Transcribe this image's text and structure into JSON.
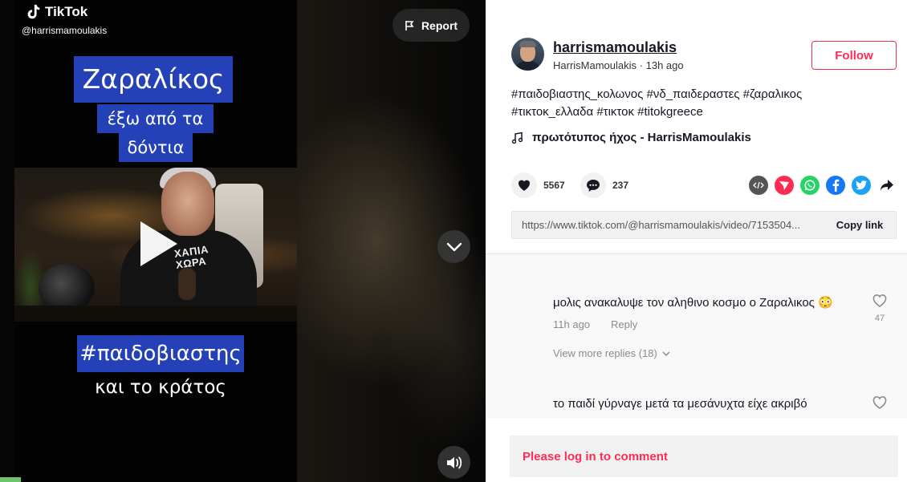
{
  "video": {
    "brand": "TikTok",
    "handle": "@harrismamoulakis",
    "report_label": "Report",
    "captions": {
      "line1": "Ζαραλίκος",
      "line2": "έξω από τα",
      "line3": "δόντια",
      "line4": "#παιδοβιαστης",
      "line5": "και το κράτος"
    },
    "shirt_text": "ΧΑΠΙΑ\nΧΩΡΑ",
    "icons": {
      "logo": "tiktok-logo-icon",
      "report": "flag-icon",
      "play": "play-icon",
      "down": "chevron-down-icon",
      "volume": "volume-icon"
    }
  },
  "post": {
    "username": "harrismamoulakis",
    "nickname": "HarrisMamoulakis",
    "time": "13h ago",
    "follow_label": "Follow",
    "caption_line1": "#παιδοβιαστης_κολωνος #νδ_παιδεραστες #ζαραλικος",
    "caption_line2": "#τικτοκ_ελλαδα #τικτοκ #titokgreece",
    "music": "πρωτότυπος ήχος - HarrisMamoulakis",
    "likes": "5567",
    "comments_count": "237",
    "share_icons": [
      "embed-icon",
      "send-icon",
      "whatsapp-icon",
      "facebook-icon",
      "twitter-icon",
      "share-arrow-icon"
    ],
    "link": "https://www.tiktok.com/@harrismamoulakis/video/7153504...",
    "copy_link_label": "Copy link"
  },
  "comments": [
    {
      "text": "μολις ανακαλυψε τον αληθινο κοσμο ο Ζαραλικος 😳",
      "time": "11h ago",
      "reply_label": "Reply",
      "likes": "47",
      "view_more": "View more replies (18)"
    },
    {
      "text": "το παιδί γύρναγε μετά τα μεσάνυχτα είχε ακριβό"
    }
  ],
  "login_prompt": "Please log in to comment",
  "colors": {
    "accent": "#fe2c55",
    "caption_bg": "#2541b7",
    "whatsapp": "#25d366",
    "facebook": "#1877f2",
    "twitter": "#1da1f2",
    "send": "#fe2c55",
    "embed": "#555555"
  }
}
